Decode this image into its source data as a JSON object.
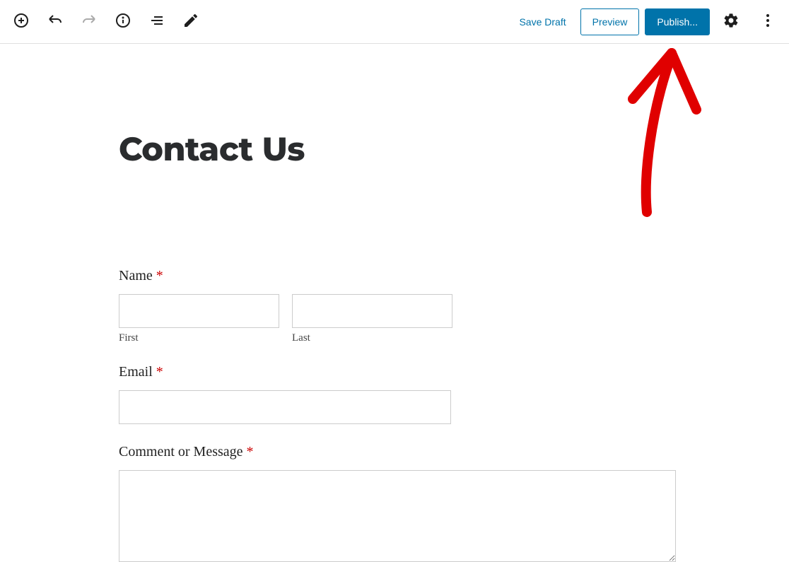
{
  "toolbar": {
    "save_draft_label": "Save Draft",
    "preview_label": "Preview",
    "publish_label": "Publish..."
  },
  "page": {
    "title": "Contact Us"
  },
  "form": {
    "name": {
      "label": "Name",
      "required_mark": "*",
      "first_sublabel": "First",
      "last_sublabel": "Last"
    },
    "email": {
      "label": "Email",
      "required_mark": "*"
    },
    "comment": {
      "label": "Comment or Message",
      "required_mark": "*"
    }
  }
}
